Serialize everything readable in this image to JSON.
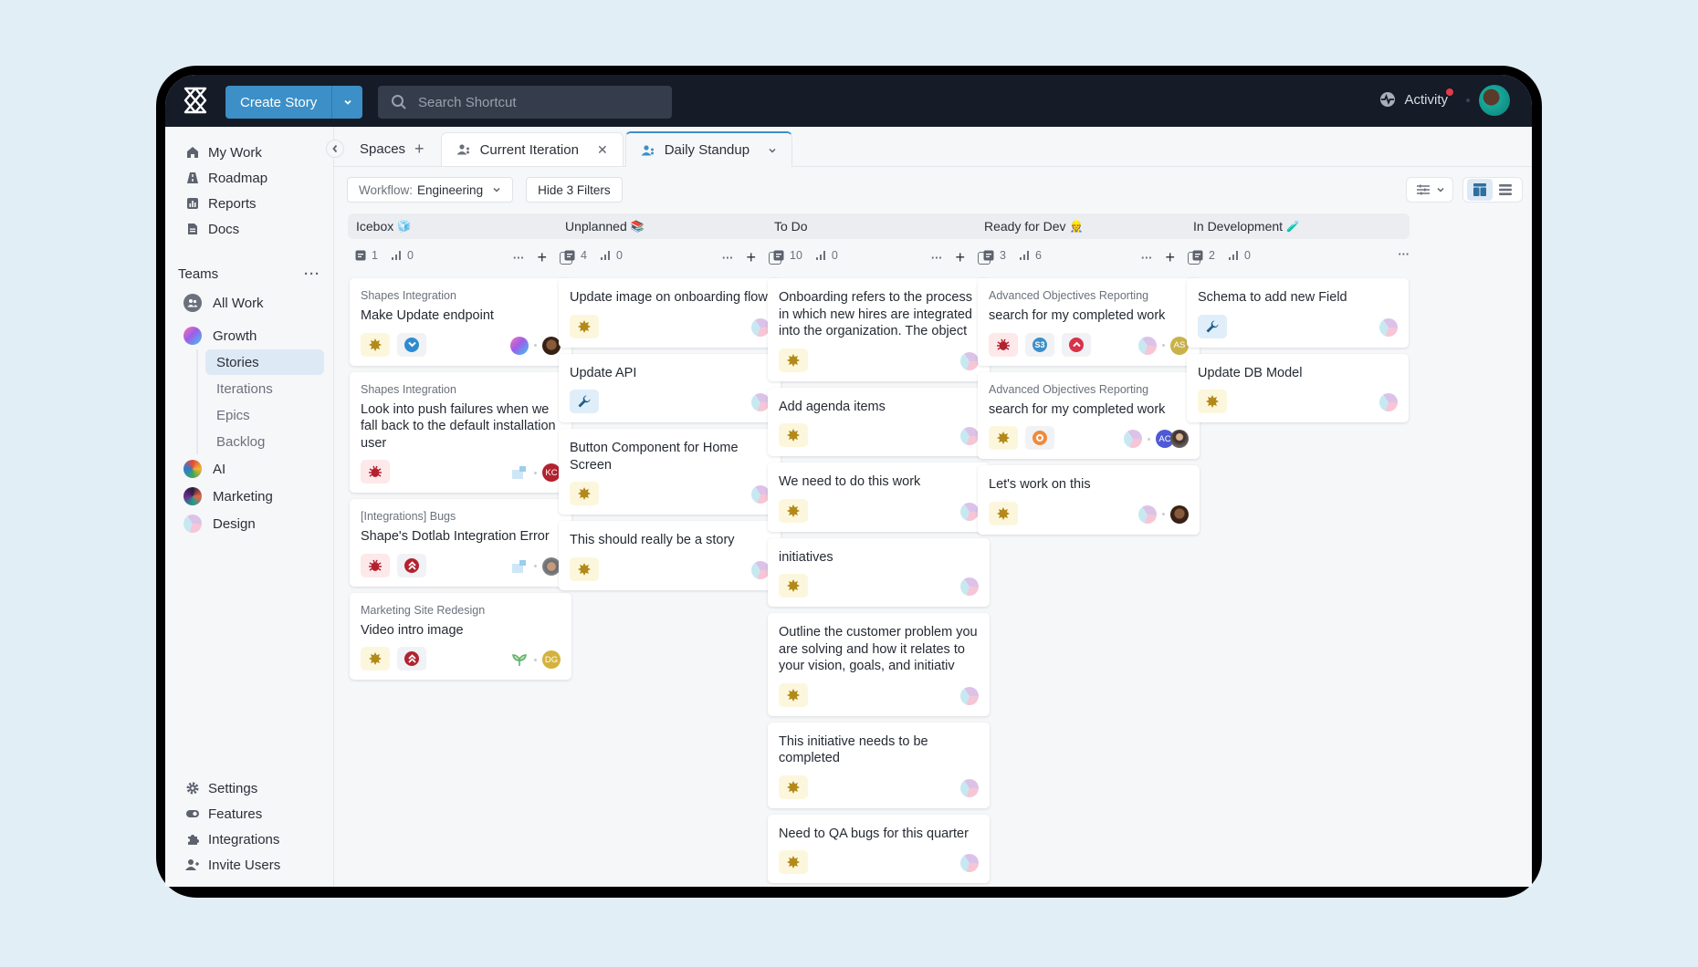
{
  "header": {
    "create_label": "Create Story",
    "search_placeholder": "Search Shortcut",
    "activity_label": "Activity"
  },
  "sidebar": {
    "nav": [
      {
        "label": "My Work",
        "icon": "home-icon"
      },
      {
        "label": "Roadmap",
        "icon": "roadmap-icon"
      },
      {
        "label": "Reports",
        "icon": "reports-icon"
      },
      {
        "label": "Docs",
        "icon": "docs-icon"
      }
    ],
    "teams_label": "Teams",
    "all_work": "All Work",
    "teams": [
      {
        "label": "Growth",
        "sub": [
          "Stories",
          "Iterations",
          "Epics",
          "Backlog"
        ],
        "active_sub": "Stories"
      },
      {
        "label": "AI"
      },
      {
        "label": "Marketing"
      },
      {
        "label": "Design"
      }
    ],
    "bottom": [
      {
        "label": "Settings",
        "icon": "gear-icon"
      },
      {
        "label": "Features",
        "icon": "toggle-icon"
      },
      {
        "label": "Integrations",
        "icon": "puzzle-icon"
      },
      {
        "label": "Invite Users",
        "icon": "add-user-icon"
      }
    ]
  },
  "tabs": [
    {
      "label": "Spaces"
    },
    {
      "label": "Current Iteration"
    },
    {
      "label": "Daily Standup",
      "active": true
    }
  ],
  "filters": {
    "workflow_prefix": "Workflow:",
    "workflow_value": "Engineering",
    "hide_filters": "Hide 3 Filters"
  },
  "columns": [
    {
      "name": "Icebox",
      "emoji": "🧊",
      "stories": "1",
      "points": "0",
      "cards": [
        {
          "epic": "Shapes Integration",
          "title": "Make Update endpoint",
          "badges": [
            "feature",
            "priority-low"
          ],
          "owners": [
            "growth",
            "photo"
          ]
        },
        {
          "epic": "Shapes Integration",
          "title": "Look into push failures when we fall back to the default installation user",
          "badges": [
            "bug"
          ],
          "owners": [
            "flag",
            "KC"
          ]
        },
        {
          "epic": "[Integrations] Bugs",
          "title": "Shape's Dotlab Integration Error",
          "badges": [
            "bug",
            "priority-highest"
          ],
          "owners": [
            "flag",
            "photo2"
          ]
        },
        {
          "epic": "Marketing Site Redesign",
          "title": "Video intro image",
          "badges": [
            "feature",
            "priority-highest"
          ],
          "owners": [
            "plant",
            "DG"
          ]
        }
      ]
    },
    {
      "name": "Unplanned",
      "emoji": "📚",
      "stories": "4",
      "points": "0",
      "cards": [
        {
          "title": "Update image on onboarding flow",
          "badges": [
            "feature"
          ],
          "owners": [
            "design"
          ]
        },
        {
          "title": "Update API",
          "badges": [
            "chore"
          ],
          "owners": [
            "design"
          ]
        },
        {
          "title": "Button Component for Home Screen",
          "badges": [
            "feature"
          ],
          "owners": [
            "design"
          ]
        },
        {
          "title": "This should really be a story",
          "badges": [
            "feature"
          ],
          "owners": [
            "design"
          ]
        }
      ]
    },
    {
      "name": "To Do",
      "emoji": "",
      "stories": "10",
      "points": "0",
      "cards": [
        {
          "title": "Onboarding refers to the process in which new hires are integrated into the organization. The object",
          "badges": [
            "feature"
          ],
          "owners": [
            "design"
          ]
        },
        {
          "title": "Add agenda items",
          "badges": [
            "feature"
          ],
          "owners": [
            "design"
          ]
        },
        {
          "title": "We need to do this work",
          "badges": [
            "feature"
          ],
          "owners": [
            "design"
          ]
        },
        {
          "title": "initiatives",
          "badges": [
            "feature"
          ],
          "owners": [
            "design"
          ]
        },
        {
          "title": "Outline the customer problem you are solving and how it relates to your vision, goals, and initiativ",
          "badges": [
            "feature"
          ],
          "owners": [
            "design"
          ]
        },
        {
          "title": "This initiative needs to be completed",
          "badges": [
            "feature"
          ],
          "owners": [
            "design"
          ]
        },
        {
          "title": "Need to QA bugs for this quarter",
          "badges": [
            "feature"
          ],
          "owners": [
            "design"
          ]
        }
      ]
    },
    {
      "name": "Ready for Dev",
      "emoji": "👷",
      "stories": "3",
      "points": "6",
      "cards": [
        {
          "epic": "Advanced Objectives Reporting",
          "title": "search for my completed work",
          "badges": [
            "bug",
            "estimate-S3",
            "priority-high"
          ],
          "owners": [
            "design",
            "AS"
          ]
        },
        {
          "epic": "Advanced Objectives Reporting",
          "title": "search for my completed work",
          "badges": [
            "feature",
            "priority-medium"
          ],
          "owners": [
            "design",
            "AC",
            "photo3"
          ]
        },
        {
          "title": "Let's work on this",
          "badges": [
            "feature"
          ],
          "owners": [
            "design",
            "photo"
          ]
        }
      ]
    },
    {
      "name": "In Development",
      "emoji": "🧪",
      "stories": "2",
      "points": "0",
      "cards": [
        {
          "title": "Schema to add new Field",
          "badges": [
            "chore"
          ],
          "owners": [
            "design"
          ]
        },
        {
          "title": "Update DB Model",
          "badges": [
            "feature"
          ],
          "owners": [
            "design"
          ]
        }
      ]
    }
  ],
  "labels": {
    "S3": "S3",
    "KC": "KC",
    "DG": "DG",
    "AS": "AS",
    "AC": "AC"
  },
  "colors": {
    "accent": "#3c8fc7",
    "topbar": "#151b27",
    "feature": "#b38a1a",
    "bug": "#b3222f",
    "chore": "#1e5f8c"
  }
}
